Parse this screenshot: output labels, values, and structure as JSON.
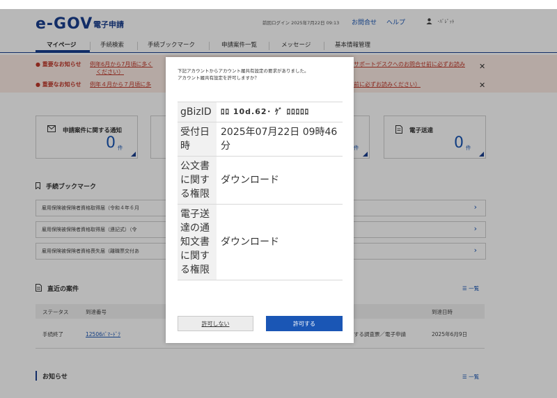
{
  "header": {
    "logo_text": "e-GOV",
    "logo_sub": "電子申請",
    "login_info": "前回ログイン 2025年7月22日 09:13",
    "contact_label": "お問合せ",
    "help_label": "ヘルプ",
    "user_name": "･ﾊﾞﾚﾟｯﾄ"
  },
  "nav": {
    "items": [
      "マイページ",
      "手続検索",
      "手続ブックマーク",
      "申請案件一覧",
      "メッセージ",
      "基本情報管理"
    ]
  },
  "notices": [
    {
      "tag": "重要なお知らせ",
      "text": "例年6月から7月頃に多く",
      "text_right": "サポートデスクへのお問合せ前に必ずお読み",
      "text_line2": "ください）"
    },
    {
      "tag": "重要なお知らせ",
      "text": "例年４月から７月頃に多",
      "text_right": "前に必ずお読みください）"
    }
  ],
  "cards": [
    {
      "title": "申請案件に関する通知",
      "count": "0",
      "unit": "件"
    },
    {
      "title": "",
      "count": "",
      "unit": "件"
    },
    {
      "title": "電子送達",
      "count": "0",
      "unit": "件"
    }
  ],
  "bookmarks": {
    "title": "手続ブックマーク",
    "items": [
      "雇用保険被保険者資格取得届（令和４年６月",
      "雇用保険被保険者資格取得届（連記式）（令",
      "雇用保険被保険者資格喪失届（離職票交付あ"
    ]
  },
  "recent": {
    "title": "直近の案件",
    "list_link": "一覧",
    "columns": [
      "ステータス",
      "到達番号",
      "到達日時"
    ],
    "row": {
      "status": "手続終了",
      "number": "12506ﾊﾞﾏｰﾄﾞﾃ",
      "proc": "する調査票／電子申請",
      "date": "2025年6月9日"
    }
  },
  "news": {
    "title": "お知らせ",
    "list_link": "一覧"
  },
  "modal": {
    "message_line1": "下記アカウントからアカウント履共有設定の要求がありました。",
    "message_line2": "アカウント履共有設定を許可しますか？",
    "rows": [
      {
        "label": "gBizID",
        "value": "ﾛﾛ 10d.62･ ｹﾞ ﾛﾛﾛﾛﾛ"
      },
      {
        "label": "受付日時",
        "value": "2025年07月22日 09時46分"
      },
      {
        "label": "公文書に関する権限",
        "value": "ダウンロード"
      },
      {
        "label": "電子送達の通知文書に関する権限",
        "value": "ダウンロード"
      }
    ],
    "deny_label": "許可しない",
    "allow_label": "許可する"
  }
}
